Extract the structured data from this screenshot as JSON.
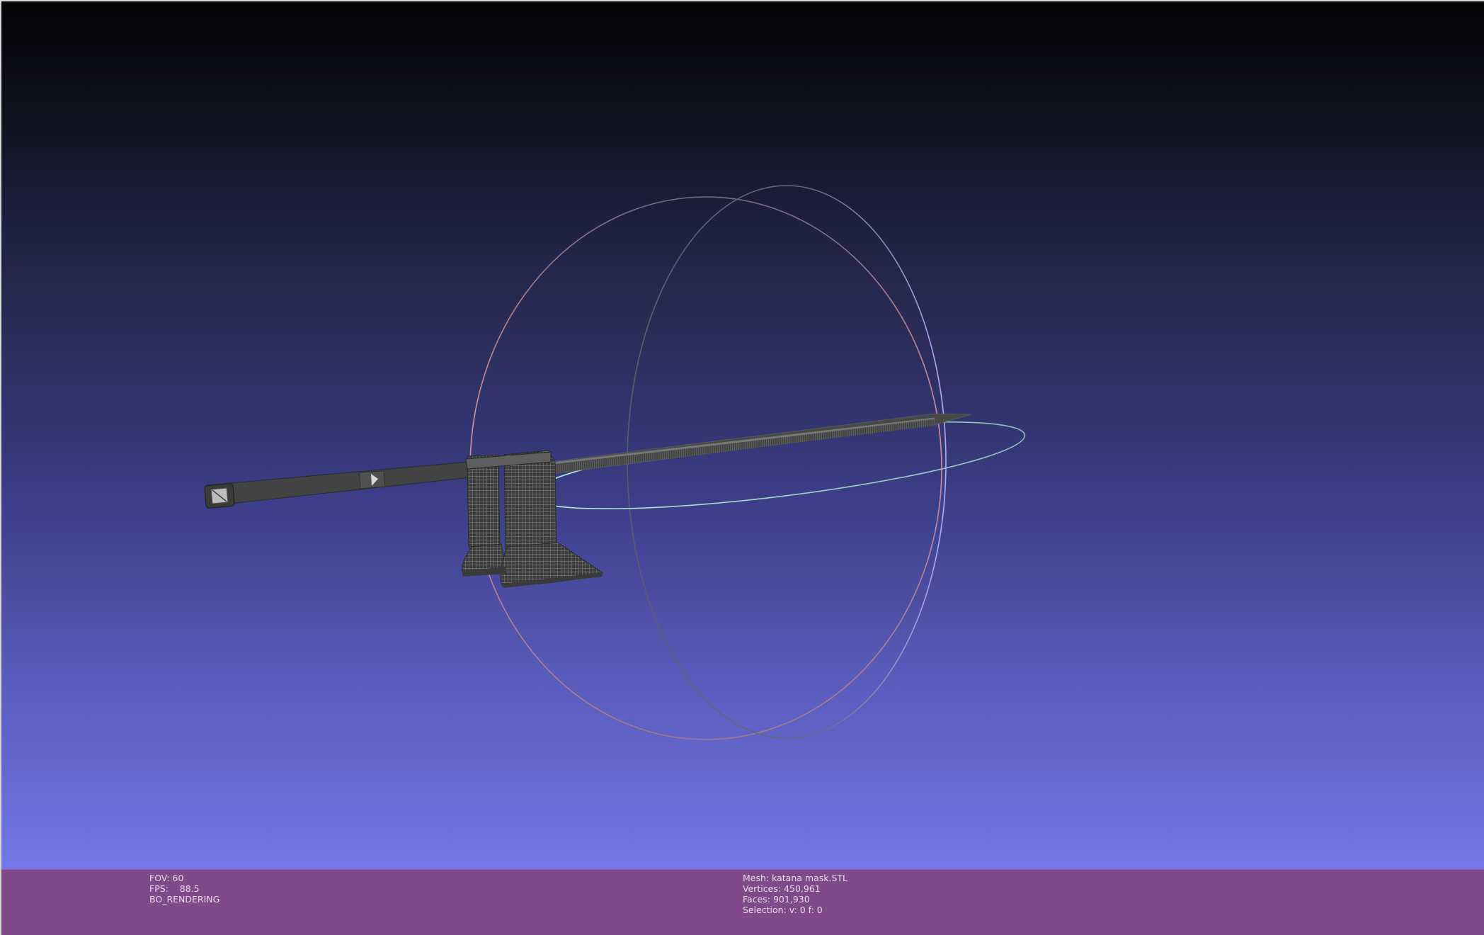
{
  "info_left": {
    "fov": "FOV: 60",
    "fps": "FPS:    88.5",
    "render_mode": "BO_RENDERING"
  },
  "info_right": {
    "mesh": "Mesh: katana mask.STL",
    "vertices": "Vertices: 450,961",
    "faces": "Faces: 901,930",
    "selection": "Selection: v: 0 f: 0"
  },
  "colors": {
    "info_bar_bg": "#804886",
    "trackball_x": "#d98a9a",
    "trackball_y": "#a79af0",
    "trackball_z": "#9ee0c8",
    "mesh": "#4a4a4a"
  },
  "icons": {
    "trackball": "trackball-rings",
    "mesh": "katana-mesh"
  }
}
